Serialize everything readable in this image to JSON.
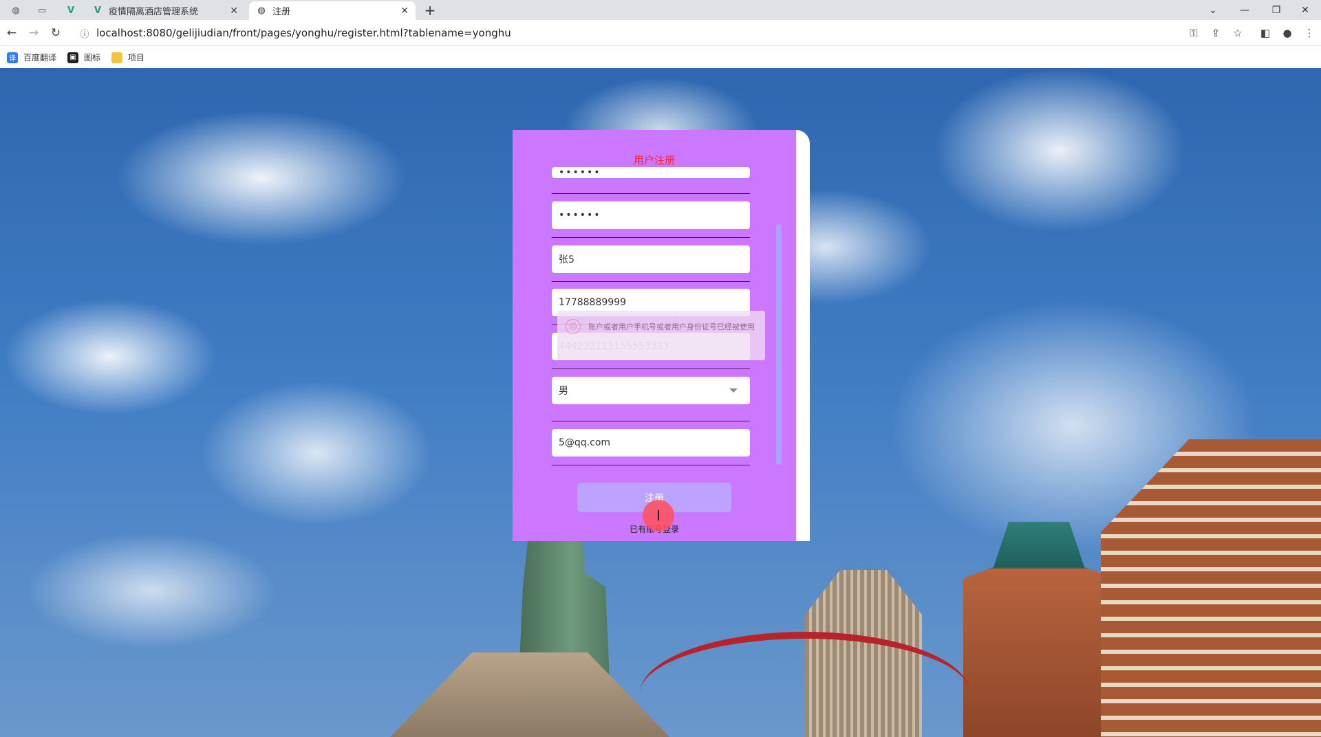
{
  "browser": {
    "tabs": [
      {
        "title": "疫情隔离酒店管理系统",
        "favicon": "vue-icon",
        "active": false
      },
      {
        "title": "注册",
        "favicon": "globe-icon",
        "active": true
      }
    ],
    "url": "localhost:8080/gelijiudian/front/pages/yonghu/register.html?tablename=yonghu",
    "bookmarks": [
      {
        "label": "百度翻译",
        "icon": "translate-icon",
        "color": "#2f7cf6"
      },
      {
        "label": "图标",
        "icon": "image-icon",
        "color": "#222222"
      },
      {
        "label": "项目",
        "icon": "folder-icon",
        "color": "#f5c542"
      }
    ]
  },
  "form": {
    "title": "用户注册",
    "fields": {
      "password": "••••••",
      "confirm_password": "••••••",
      "name": "张5",
      "phone": "17788889999",
      "id_number": "444222111155553333",
      "gender": "男",
      "email": "5@qq.com"
    },
    "submit_label": "注册",
    "login_link": "已有账号登录"
  },
  "toast": {
    "message": "账户或者用户手机号或者用户身份证号已经被使用"
  },
  "colors": {
    "card": "#cc77ff",
    "title": "#ff2222",
    "submit": "#bba3ff",
    "scrollbar": "#a9a4f7"
  }
}
